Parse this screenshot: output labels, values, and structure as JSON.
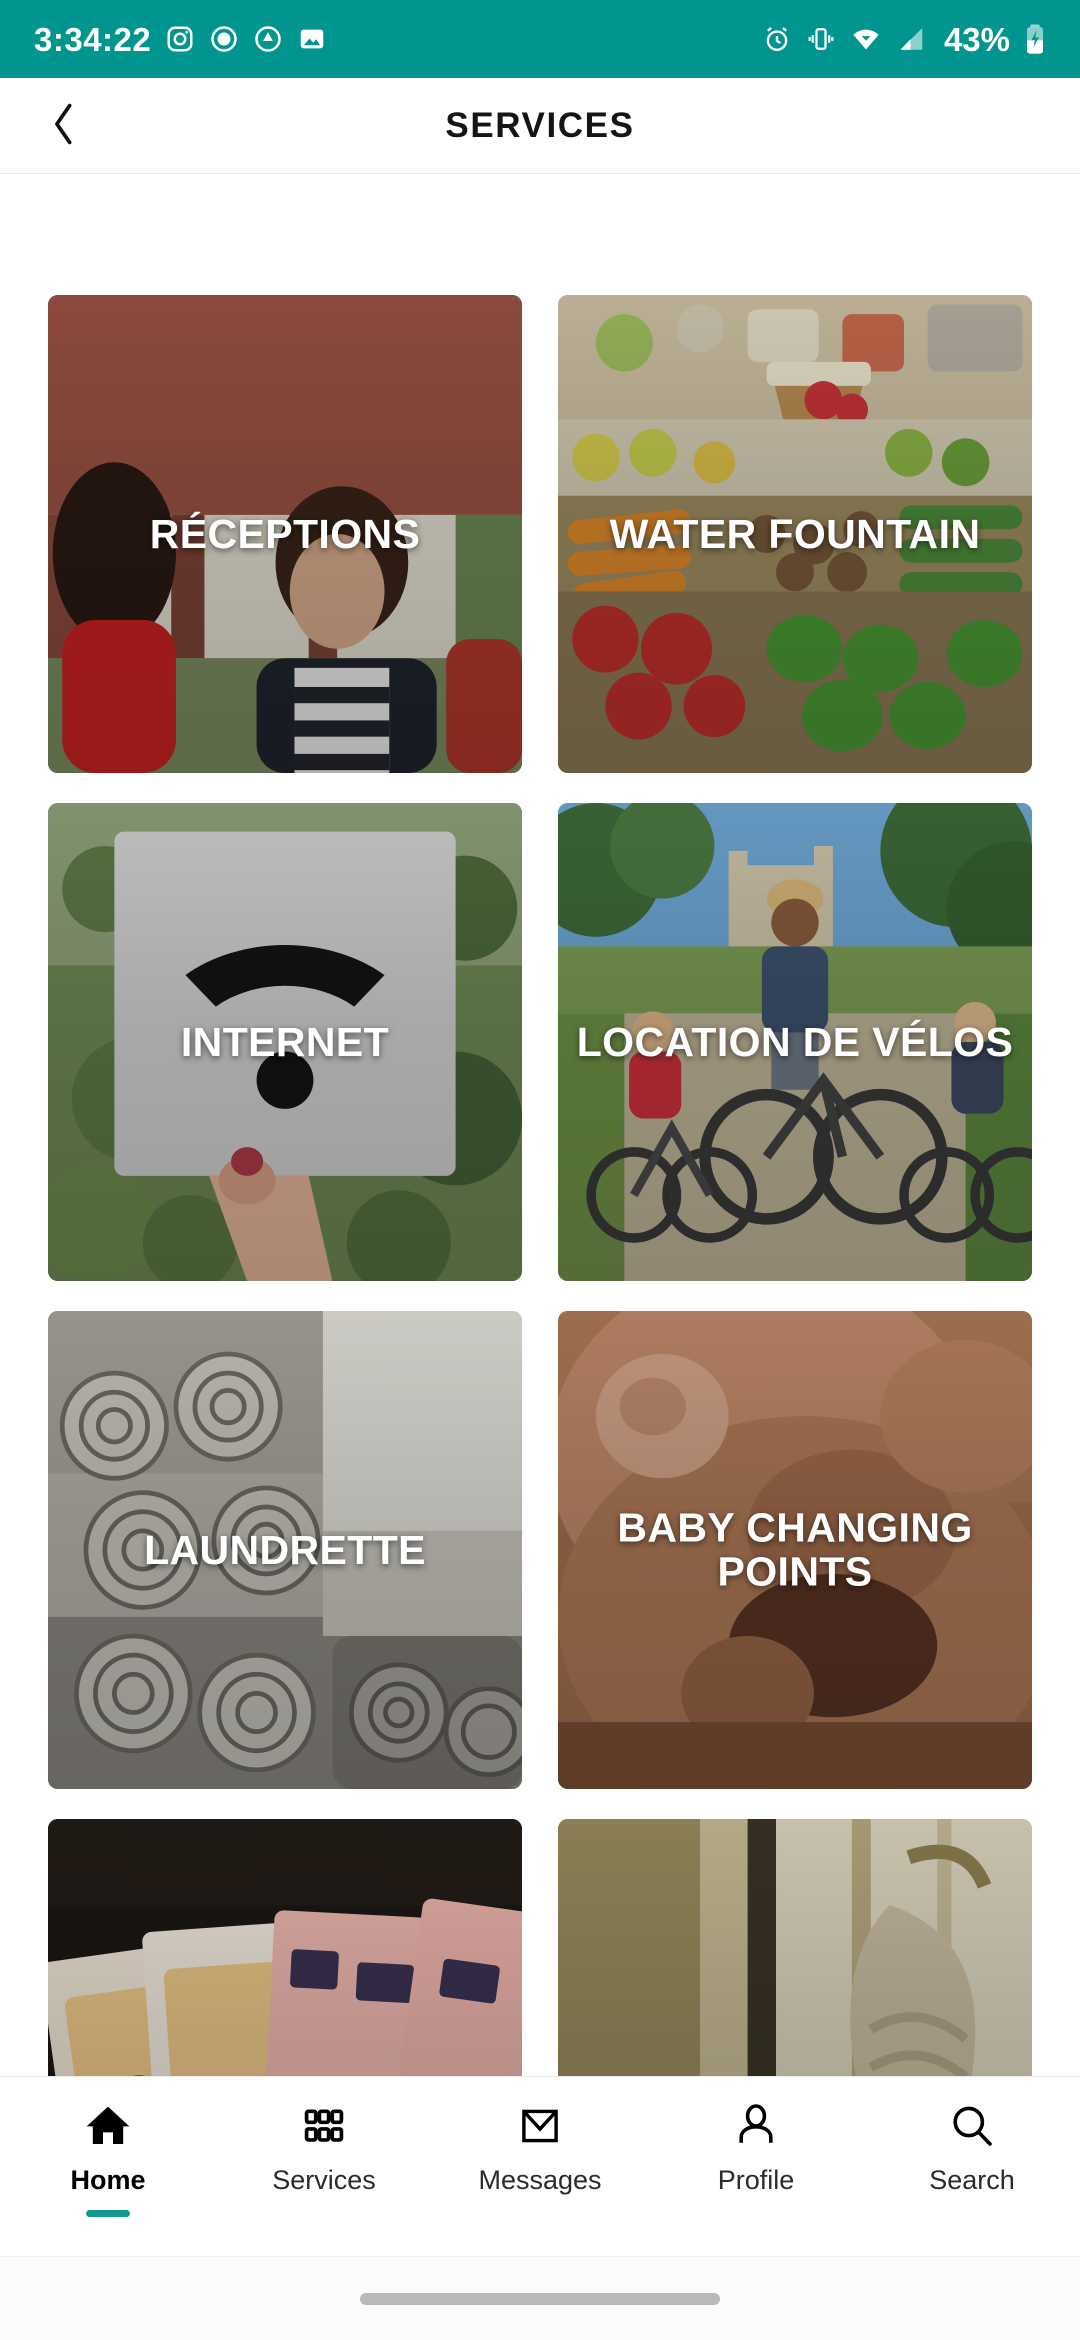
{
  "status_bar": {
    "time": "3:34:22",
    "battery_percent": "43%",
    "background_color": "#00968F",
    "left_icons": [
      "camera-icon",
      "record-icon",
      "do-not-disturb-icon",
      "screenshot-image-icon"
    ],
    "right_icons": [
      "alarm-icon",
      "vibrate-icon",
      "wifi-icon",
      "cellular-signal-icon",
      "battery-charging-icon"
    ]
  },
  "app_bar": {
    "title": "SERVICES",
    "back_icon": "chevron-left-icon"
  },
  "services": [
    {
      "label": "RÉCEPTIONS",
      "image": "reception-desk-photo"
    },
    {
      "label": "WATER FOUNTAIN",
      "image": "market-vegetables-photo"
    },
    {
      "label": "INTERNET",
      "image": "wifi-sign-hand-photo"
    },
    {
      "label": "LOCATION DE VÉLOS",
      "image": "family-cycling-photo"
    },
    {
      "label": "LAUNDRETTE",
      "image": "rolled-towels-photo"
    },
    {
      "label": "BABY CHANGING POINTS",
      "image": "baby-face-photo"
    },
    {
      "label": "",
      "image": "euro-banknotes-photo"
    },
    {
      "label": "",
      "image": "wooden-door-photo"
    }
  ],
  "bottom_nav": {
    "active_index": 0,
    "accent_color": "#139A93",
    "items": [
      {
        "label": "Home",
        "icon": "home-icon"
      },
      {
        "label": "Services",
        "icon": "grid-dots-icon"
      },
      {
        "label": "Messages",
        "icon": "envelope-icon"
      },
      {
        "label": "Profile",
        "icon": "person-icon"
      },
      {
        "label": "Search",
        "icon": "magnifier-icon"
      }
    ]
  }
}
